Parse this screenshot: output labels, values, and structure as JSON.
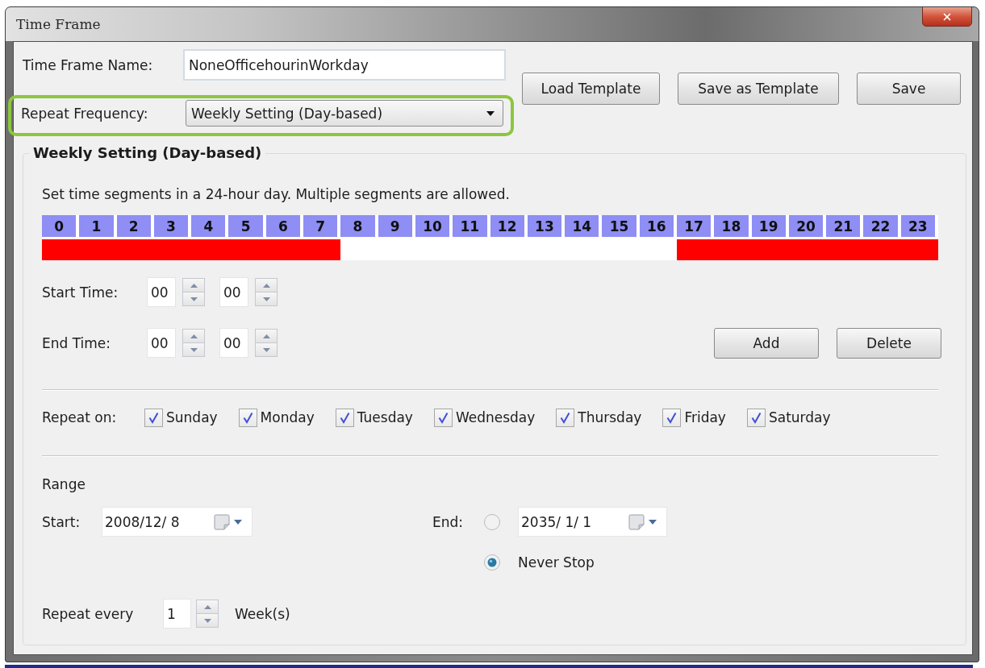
{
  "window": {
    "title": "Time Frame"
  },
  "form": {
    "name_label": "Time Frame Name:",
    "name_value": "NoneOfficehourinWorkday",
    "frequency_label": "Repeat Frequency:",
    "frequency_value": "Weekly Setting (Day-based)",
    "frequency_highlighted": true
  },
  "toolbar": {
    "buttons": [
      "Load Template",
      "Save as Template",
      "Save"
    ]
  },
  "weekly_setting": {
    "title": "Weekly Setting (Day-based)",
    "instruction": "Set time segments in a 24-hour day. Multiple segments are allowed.",
    "hours": [
      {
        "label": "0",
        "selected": true
      },
      {
        "label": "1",
        "selected": true
      },
      {
        "label": "2",
        "selected": true
      },
      {
        "label": "3",
        "selected": true
      },
      {
        "label": "4",
        "selected": true
      },
      {
        "label": "5",
        "selected": true
      },
      {
        "label": "6",
        "selected": true
      },
      {
        "label": "7",
        "selected": true
      },
      {
        "label": "8",
        "selected": false
      },
      {
        "label": "9",
        "selected": false
      },
      {
        "label": "10",
        "selected": false
      },
      {
        "label": "11",
        "selected": false
      },
      {
        "label": "12",
        "selected": false
      },
      {
        "label": "13",
        "selected": false
      },
      {
        "label": "14",
        "selected": false
      },
      {
        "label": "15",
        "selected": false
      },
      {
        "label": "16",
        "selected": false
      },
      {
        "label": "17",
        "selected": true
      },
      {
        "label": "18",
        "selected": true
      },
      {
        "label": "19",
        "selected": true
      },
      {
        "label": "20",
        "selected": true
      },
      {
        "label": "21",
        "selected": true
      },
      {
        "label": "22",
        "selected": true
      },
      {
        "label": "23",
        "selected": true
      }
    ],
    "start_time": {
      "label": "Start Time:",
      "hour": "00",
      "minute": "00"
    },
    "end_time": {
      "label": "End Time:",
      "hour": "00",
      "minute": "00"
    },
    "segment_buttons": [
      "Add",
      "Delete"
    ],
    "repeat_on": {
      "label": "Repeat on:",
      "days": [
        {
          "label": "Sunday",
          "checked": true
        },
        {
          "label": "Monday",
          "checked": true
        },
        {
          "label": "Tuesday",
          "checked": true
        },
        {
          "label": "Wednesday",
          "checked": true
        },
        {
          "label": "Thursday",
          "checked": true
        },
        {
          "label": "Friday",
          "checked": true
        },
        {
          "label": "Saturday",
          "checked": true
        }
      ]
    },
    "range": {
      "title": "Range",
      "start_label": "Start:",
      "start_date": "2008/12/ 8",
      "end_label": "End:",
      "end_options": [
        {
          "kind": "date",
          "value": "2035/ 1/ 1",
          "selected": false
        },
        {
          "kind": "never",
          "label": "Never Stop",
          "selected": true
        }
      ]
    },
    "repeat_every": {
      "label": "Repeat every",
      "value": "1",
      "unit": "Week(s)"
    }
  }
}
